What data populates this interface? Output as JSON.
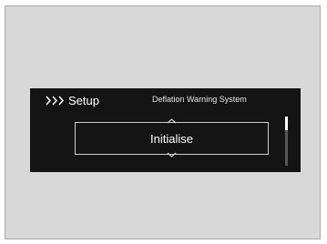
{
  "header": {
    "breadcrumb_label": "Setup",
    "title": "Deflation Warning System"
  },
  "selector": {
    "current_value": "Initialise"
  },
  "icons": {
    "breadcrumb": "triple-chevron-right-icon",
    "up": "chevron-up-icon",
    "down": "chevron-down-icon"
  },
  "colors": {
    "screen_background": "#141414",
    "text": "#ffffff",
    "frame_background": "#d8d8d8"
  }
}
